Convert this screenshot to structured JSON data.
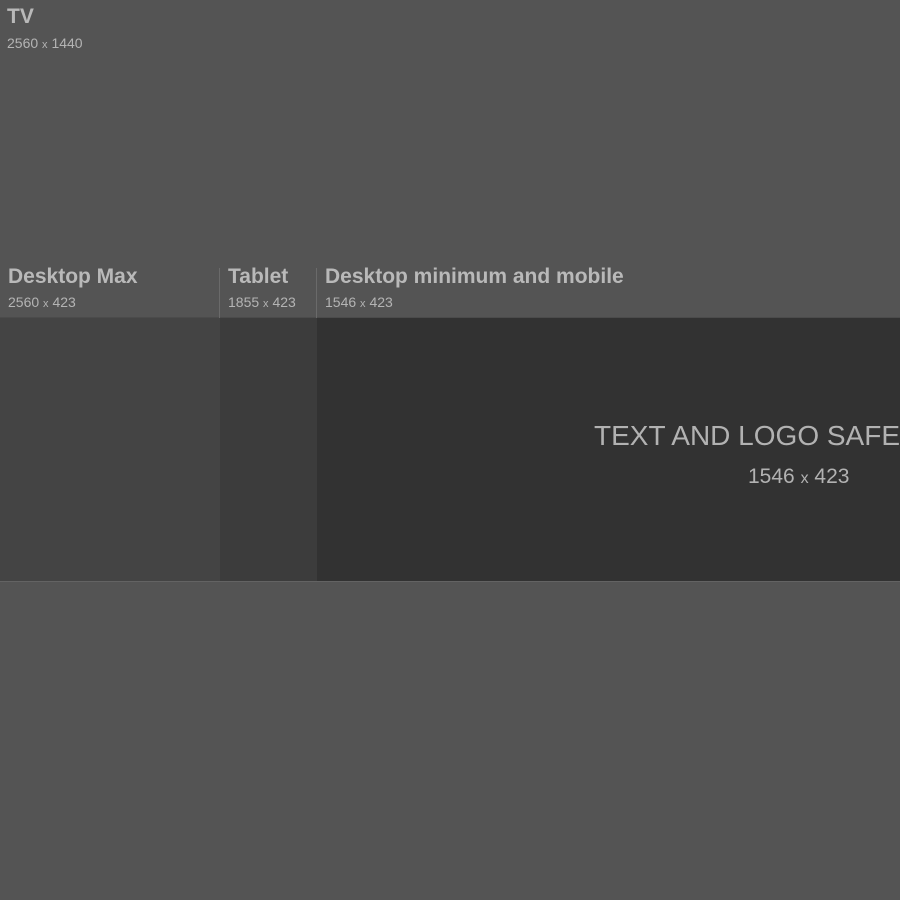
{
  "tv": {
    "title": "TV",
    "width": "2560",
    "sep": "x",
    "height": "1440"
  },
  "desktop_max": {
    "title": "Desktop Max",
    "width": "2560",
    "sep": "x",
    "height": "423"
  },
  "tablet": {
    "title": "Tablet",
    "width": "1855",
    "sep": "x",
    "height": "423"
  },
  "desktop_min": {
    "title": "Desktop minimum and mobile",
    "width": "1546",
    "sep": "x",
    "height": "423"
  },
  "safe_area": {
    "title": "TEXT AND LOGO SAFE AREA",
    "width": "1546",
    "sep": "x",
    "height": "423"
  },
  "colors": {
    "background": "#545454",
    "desktop_max_band": "#444444",
    "tablet_band": "#3c3c3c",
    "safe_area_band": "#323232",
    "label_text": "#b9b9b9"
  }
}
